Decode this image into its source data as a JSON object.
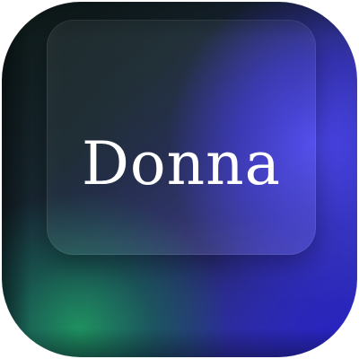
{
  "app_icon": {
    "wordmark": "Donna",
    "colors": {
      "green_glow": "#1e965f",
      "blue_glow": "#4b46eb",
      "dark_base": "#0e1a18",
      "text": "#ffffff"
    }
  }
}
